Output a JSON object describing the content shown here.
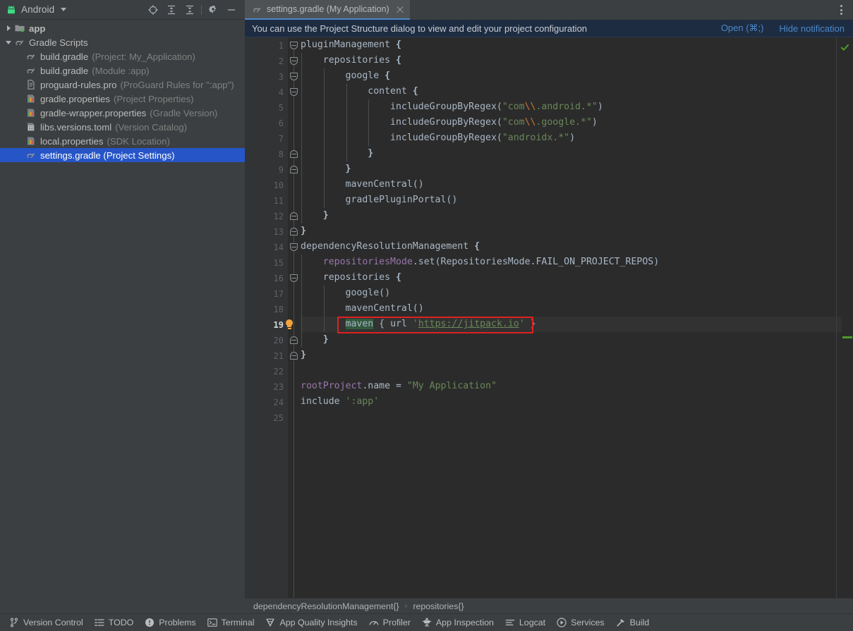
{
  "project_panel": {
    "title": "Android",
    "title_icon": "android-robot-icon",
    "dropdown_icon": "chevron-down-icon",
    "tools": [
      {
        "name": "select-opened-file-icon",
        "label": "Select Opened File"
      },
      {
        "name": "expand-all-icon",
        "label": "Expand All"
      },
      {
        "name": "collapse-all-icon",
        "label": "Collapse All"
      },
      {
        "name": "settings-gear-icon",
        "label": "Options"
      },
      {
        "name": "hide-panel-icon",
        "label": "Hide"
      }
    ],
    "tree": [
      {
        "twisty": "right",
        "icon": "module-folder-icon",
        "label": "app",
        "sub": "",
        "bold": true,
        "selected": false,
        "indent": 0
      },
      {
        "twisty": "down",
        "icon": "gradle-elephant-icon",
        "label": "Gradle Scripts",
        "sub": "",
        "bold": false,
        "selected": false,
        "indent": 0
      },
      {
        "twisty": "none",
        "icon": "gradle-elephant-icon",
        "label": "build.gradle",
        "sub": "(Project: My_Application)",
        "bold": false,
        "selected": false,
        "indent": 1
      },
      {
        "twisty": "none",
        "icon": "gradle-elephant-icon",
        "label": "build.gradle",
        "sub": "(Module :app)",
        "bold": false,
        "selected": false,
        "indent": 1
      },
      {
        "twisty": "none",
        "icon": "text-file-icon",
        "label": "proguard-rules.pro",
        "sub": "(ProGuard Rules for \":app\")",
        "bold": false,
        "selected": false,
        "indent": 1
      },
      {
        "twisty": "none",
        "icon": "properties-file-icon",
        "label": "gradle.properties",
        "sub": "(Project Properties)",
        "bold": false,
        "selected": false,
        "indent": 1
      },
      {
        "twisty": "none",
        "icon": "properties-file-icon",
        "label": "gradle-wrapper.properties",
        "sub": "(Gradle Version)",
        "bold": false,
        "selected": false,
        "indent": 1
      },
      {
        "twisty": "none",
        "icon": "toml-file-icon",
        "label": "libs.versions.toml",
        "sub": "(Version Catalog)",
        "bold": false,
        "selected": false,
        "indent": 1
      },
      {
        "twisty": "none",
        "icon": "properties-file-icon",
        "label": "local.properties",
        "sub": "(SDK Location)",
        "bold": false,
        "selected": false,
        "indent": 1
      },
      {
        "twisty": "none",
        "icon": "gradle-elephant-icon",
        "label": "settings.gradle (Project Settings)",
        "sub": "",
        "bold": false,
        "selected": true,
        "indent": 1
      }
    ]
  },
  "editor": {
    "tab": {
      "label": "settings.gradle (My Application)",
      "icon": "gradle-elephant-icon",
      "close_icon": "close-icon"
    },
    "more_options_icon": "kebab-menu-icon",
    "notification": {
      "text": "You can use the Project Structure dialog to view and edit your project configuration",
      "open_link": "Open (⌘;)",
      "hide_link": "Hide notification"
    },
    "current_line": 19,
    "line_count": 25,
    "inspection_status_icon": "green-check-icon",
    "quickfix_icon": "lightbulb-icon",
    "highlight_box_color": "#e02020",
    "lines": [
      {
        "n": 1,
        "fold": "open",
        "indent_guides": [],
        "tokens": [
          {
            "t": "pluginManagement ",
            "c": "c-def"
          },
          {
            "t": "{",
            "c": "c-brace"
          }
        ]
      },
      {
        "n": 2,
        "fold": "open",
        "indent_guides": [
          0
        ],
        "tokens": [
          {
            "t": "    repositories ",
            "c": "c-def"
          },
          {
            "t": "{",
            "c": "c-brace"
          }
        ]
      },
      {
        "n": 3,
        "fold": "open",
        "indent_guides": [
          0,
          1
        ],
        "tokens": [
          {
            "t": "        google ",
            "c": "c-def"
          },
          {
            "t": "{",
            "c": "c-brace"
          }
        ]
      },
      {
        "n": 4,
        "fold": "open",
        "indent_guides": [
          0,
          1,
          2
        ],
        "tokens": [
          {
            "t": "            content ",
            "c": "c-def"
          },
          {
            "t": "{",
            "c": "c-brace"
          }
        ]
      },
      {
        "n": 5,
        "fold": "none",
        "indent_guides": [
          0,
          1,
          2,
          3
        ],
        "tokens": [
          {
            "t": "                includeGroupByRegex(",
            "c": "c-def"
          },
          {
            "t": "\"com",
            "c": "c-str"
          },
          {
            "t": "\\\\",
            "c": "c-esc"
          },
          {
            "t": ".android.*\"",
            "c": "c-str"
          },
          {
            "t": ")",
            "c": "c-def"
          }
        ]
      },
      {
        "n": 6,
        "fold": "none",
        "indent_guides": [
          0,
          1,
          2,
          3
        ],
        "tokens": [
          {
            "t": "                includeGroupByRegex(",
            "c": "c-def"
          },
          {
            "t": "\"com",
            "c": "c-str"
          },
          {
            "t": "\\\\",
            "c": "c-esc"
          },
          {
            "t": ".google.*\"",
            "c": "c-str"
          },
          {
            "t": ")",
            "c": "c-def"
          }
        ]
      },
      {
        "n": 7,
        "fold": "none",
        "indent_guides": [
          0,
          1,
          2,
          3
        ],
        "tokens": [
          {
            "t": "                includeGroupByRegex(",
            "c": "c-def"
          },
          {
            "t": "\"androidx.*\"",
            "c": "c-str"
          },
          {
            "t": ")",
            "c": "c-def"
          }
        ]
      },
      {
        "n": 8,
        "fold": "close",
        "indent_guides": [
          0,
          1,
          2
        ],
        "tokens": [
          {
            "t": "            ",
            "c": "c-def"
          },
          {
            "t": "}",
            "c": "c-brace"
          }
        ]
      },
      {
        "n": 9,
        "fold": "close",
        "indent_guides": [
          0,
          1
        ],
        "tokens": [
          {
            "t": "        ",
            "c": "c-def"
          },
          {
            "t": "}",
            "c": "c-brace"
          }
        ]
      },
      {
        "n": 10,
        "fold": "none",
        "indent_guides": [
          0,
          1
        ],
        "tokens": [
          {
            "t": "        mavenCentral()",
            "c": "c-def"
          }
        ]
      },
      {
        "n": 11,
        "fold": "none",
        "indent_guides": [
          0,
          1
        ],
        "tokens": [
          {
            "t": "        gradlePluginPortal()",
            "c": "c-def"
          }
        ]
      },
      {
        "n": 12,
        "fold": "close",
        "indent_guides": [
          0
        ],
        "tokens": [
          {
            "t": "    ",
            "c": "c-def"
          },
          {
            "t": "}",
            "c": "c-brace"
          }
        ]
      },
      {
        "n": 13,
        "fold": "close",
        "indent_guides": [],
        "tokens": [
          {
            "t": "}",
            "c": "c-brace"
          }
        ]
      },
      {
        "n": 14,
        "fold": "open",
        "indent_guides": [],
        "tokens": [
          {
            "t": "dependencyResolutionManagement ",
            "c": "c-def"
          },
          {
            "t": "{",
            "c": "c-brace"
          }
        ]
      },
      {
        "n": 15,
        "fold": "none",
        "indent_guides": [
          0
        ],
        "tokens": [
          {
            "t": "    ",
            "c": "c-def"
          },
          {
            "t": "repositoriesMode",
            "c": "c-prop"
          },
          {
            "t": ".set(RepositoriesMode.FAIL_ON_PROJECT_REPOS)",
            "c": "c-def"
          }
        ]
      },
      {
        "n": 16,
        "fold": "open",
        "indent_guides": [
          0
        ],
        "tokens": [
          {
            "t": "    repositories ",
            "c": "c-def"
          },
          {
            "t": "{",
            "c": "c-brace"
          }
        ]
      },
      {
        "n": 17,
        "fold": "none",
        "indent_guides": [
          0,
          1
        ],
        "tokens": [
          {
            "t": "        google()",
            "c": "c-def"
          }
        ]
      },
      {
        "n": 18,
        "fold": "none",
        "indent_guides": [
          0,
          1
        ],
        "tokens": [
          {
            "t": "        mavenCentral()",
            "c": "c-def"
          }
        ]
      },
      {
        "n": 19,
        "fold": "none",
        "indent_guides": [
          0,
          1
        ],
        "highlight": true,
        "tokens": [
          {
            "t": "        ",
            "c": "c-def"
          },
          {
            "t": "maven",
            "c": "c-def occ"
          },
          {
            "t": " { ",
            "c": "c-def"
          },
          {
            "t": "url",
            "c": "c-def"
          },
          {
            "t": " ",
            "c": "c-def"
          },
          {
            "t": "'",
            "c": "c-str"
          },
          {
            "t": "https://jitpack.io",
            "c": "c-url"
          },
          {
            "t": "'",
            "c": "c-str"
          },
          {
            "t": " }",
            "c": "c-def"
          }
        ]
      },
      {
        "n": 20,
        "fold": "close",
        "indent_guides": [
          0
        ],
        "tokens": [
          {
            "t": "    ",
            "c": "c-def"
          },
          {
            "t": "}",
            "c": "c-brace"
          }
        ]
      },
      {
        "n": 21,
        "fold": "close",
        "indent_guides": [],
        "tokens": [
          {
            "t": "}",
            "c": "c-brace"
          }
        ]
      },
      {
        "n": 22,
        "fold": "none",
        "indent_guides": [],
        "tokens": [
          {
            "t": "",
            "c": "c-def"
          }
        ]
      },
      {
        "n": 23,
        "fold": "none",
        "indent_guides": [],
        "tokens": [
          {
            "t": "rootProject",
            "c": "c-prop"
          },
          {
            "t": ".name = ",
            "c": "c-def"
          },
          {
            "t": "\"My Application\"",
            "c": "c-str"
          }
        ]
      },
      {
        "n": 24,
        "fold": "none",
        "indent_guides": [],
        "tokens": [
          {
            "t": "include ",
            "c": "c-def"
          },
          {
            "t": "':app'",
            "c": "c-str"
          }
        ]
      },
      {
        "n": 25,
        "fold": "none",
        "indent_guides": [],
        "tokens": [
          {
            "t": "",
            "c": "c-def"
          }
        ]
      }
    ],
    "breadcrumbs": [
      "dependencyResolutionManagement{}",
      "repositories{}"
    ],
    "breadcrumb_separator": "›"
  },
  "statusbar": {
    "items": [
      {
        "icon": "version-control-branch-icon",
        "label": "Version Control"
      },
      {
        "icon": "todo-list-icon",
        "label": "TODO"
      },
      {
        "icon": "problems-warning-icon",
        "label": "Problems"
      },
      {
        "icon": "terminal-prompt-icon",
        "label": "Terminal"
      },
      {
        "icon": "app-quality-insights-gem-icon",
        "label": "App Quality Insights"
      },
      {
        "icon": "profiler-gauge-icon",
        "label": "Profiler"
      },
      {
        "icon": "app-inspection-icon",
        "label": "App Inspection"
      },
      {
        "icon": "logcat-lines-icon",
        "label": "Logcat"
      },
      {
        "icon": "services-play-icon",
        "label": "Services"
      },
      {
        "icon": "build-hammer-icon",
        "label": "Build"
      }
    ]
  }
}
